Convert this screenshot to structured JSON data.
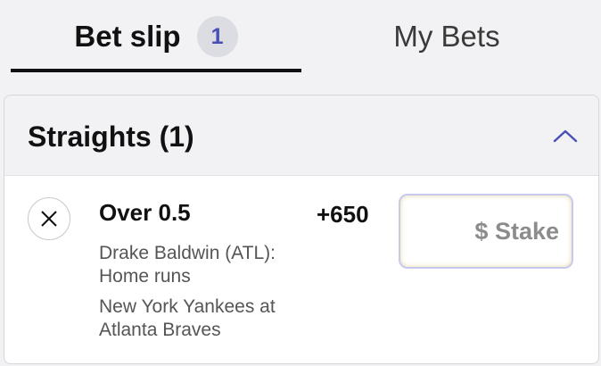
{
  "tabs": {
    "bet_slip_label": "Bet slip",
    "bet_slip_count": "1",
    "my_bets_label": "My Bets"
  },
  "section": {
    "title": "Straights (1)",
    "collapse_icon": "chevron-up-icon"
  },
  "bet": {
    "remove_icon": "close-icon",
    "selection": "Over 0.5",
    "odds": "+650",
    "market": "Drake Baldwin (ATL): Home runs",
    "event": "New York Yankees at Atlanta Braves"
  },
  "stake": {
    "value": "",
    "placeholder": "$ Stake"
  },
  "colors": {
    "accent": "#4a4fb5",
    "badge_bg": "#dcdde3",
    "header_bg": "#f2f2f4",
    "stake_border": "#c7c9ee"
  }
}
